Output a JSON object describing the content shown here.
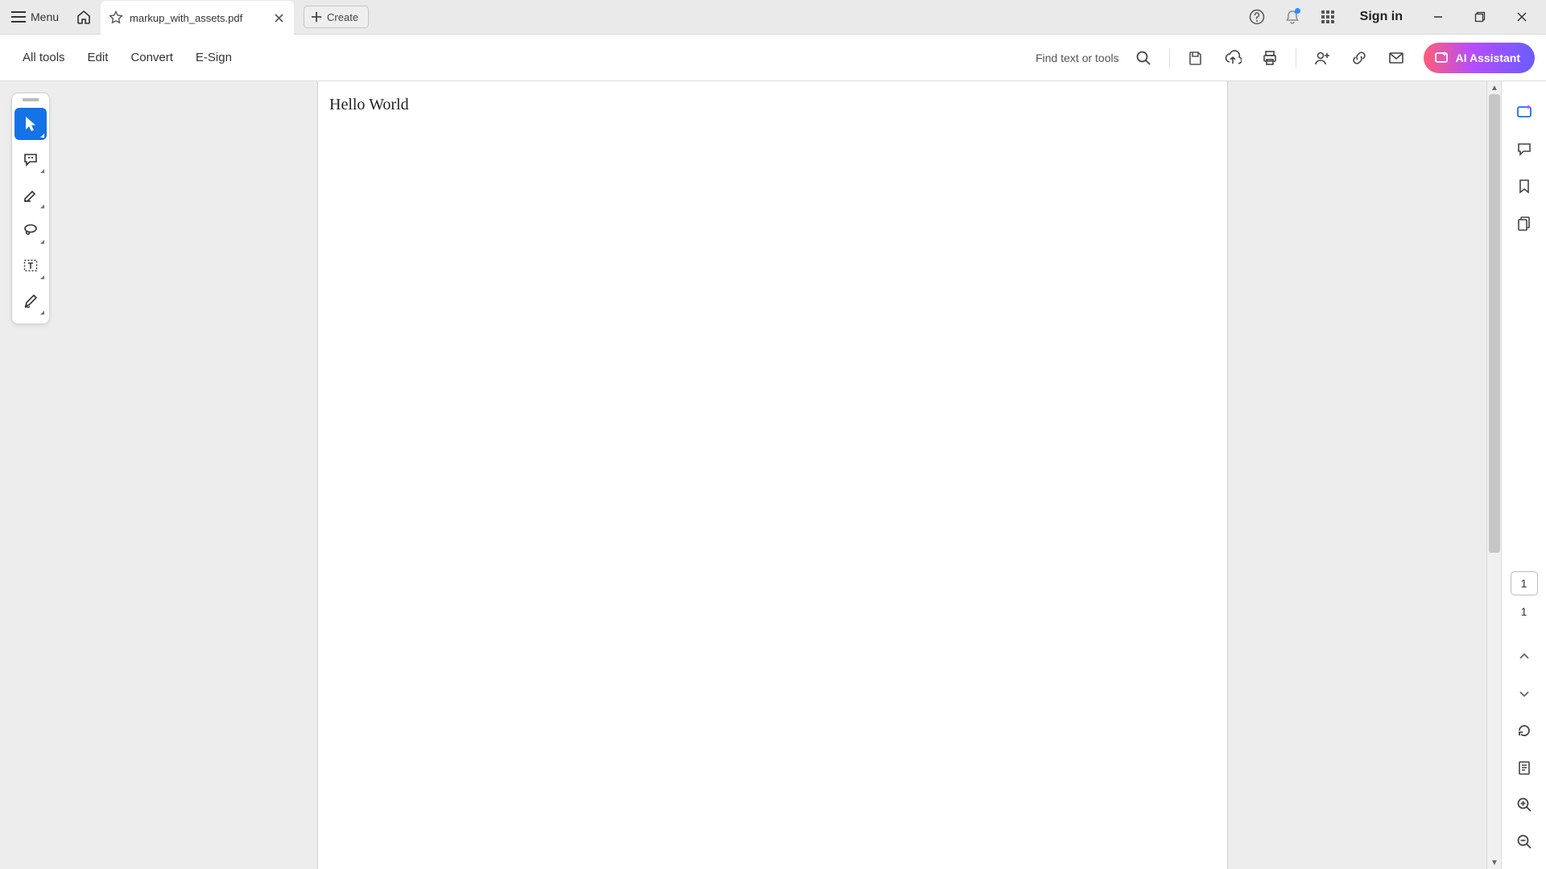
{
  "tabbar": {
    "menu_label": "Menu",
    "tab_title": "markup_with_assets.pdf",
    "create_label": "Create",
    "signin_label": "Sign in"
  },
  "menubar": {
    "items": [
      "All tools",
      "Edit",
      "Convert",
      "E-Sign"
    ],
    "find_label": "Find text or tools",
    "ai_label": "AI Assistant"
  },
  "document": {
    "body_text": "Hello World"
  },
  "pager": {
    "current": "1",
    "total": "1"
  }
}
